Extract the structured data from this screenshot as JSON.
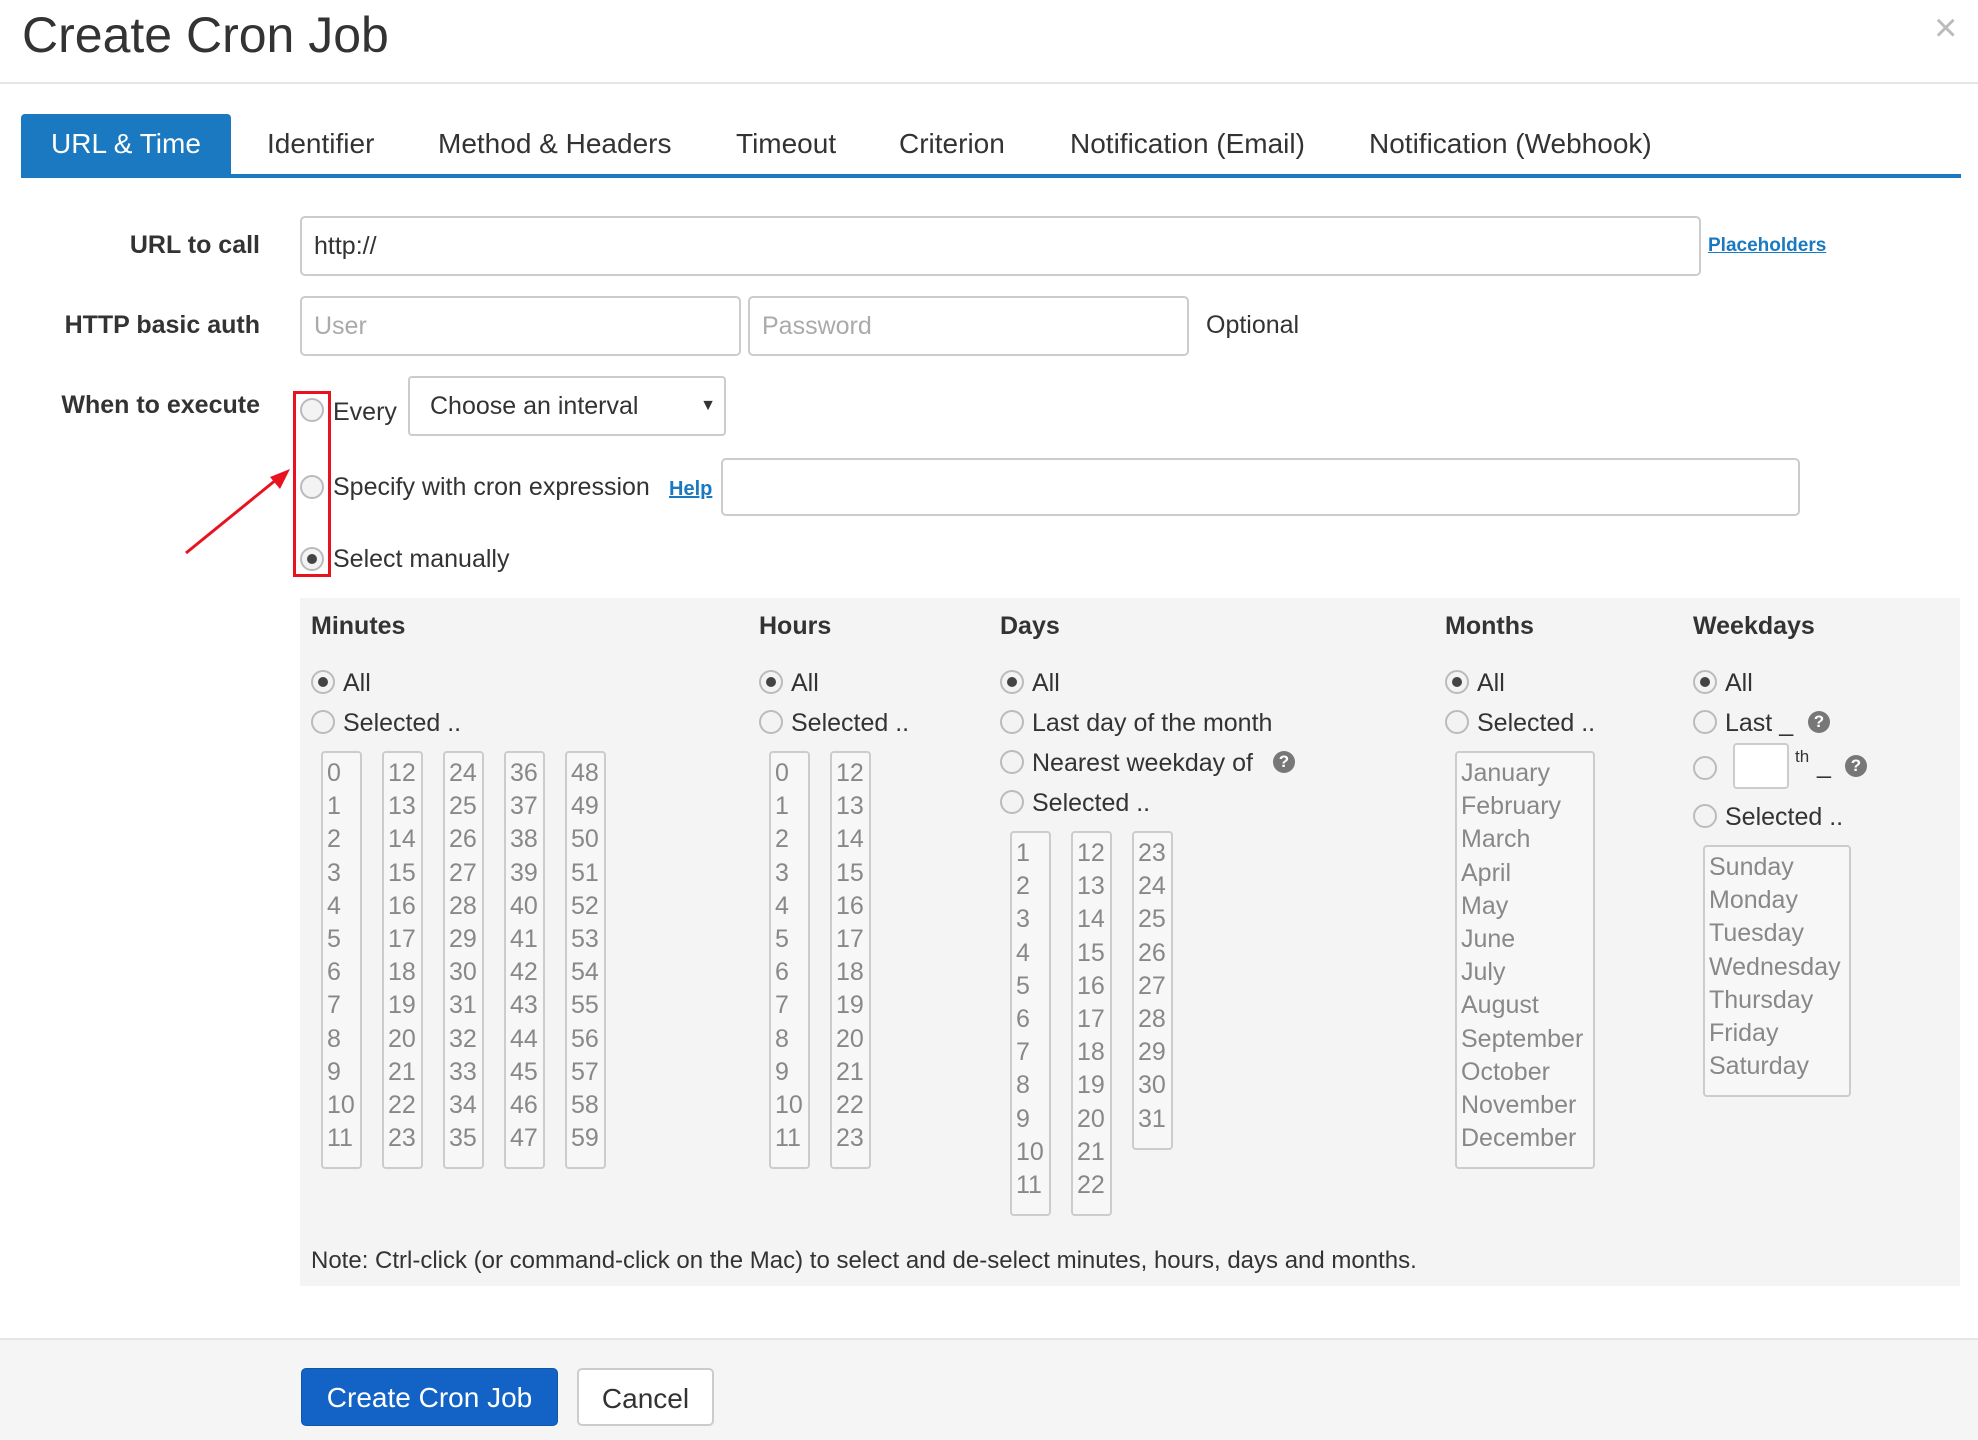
{
  "dialog": {
    "title": "Create Cron Job",
    "close": "×"
  },
  "tabs": [
    {
      "label": "URL & Time"
    },
    {
      "label": "Identifier"
    },
    {
      "label": "Method & Headers"
    },
    {
      "label": "Timeout"
    },
    {
      "label": "Criterion"
    },
    {
      "label": "Notification (Email)"
    },
    {
      "label": "Notification (Webhook)"
    }
  ],
  "url": {
    "label": "URL to call",
    "value": "http://",
    "placeholders_link": "Placeholders"
  },
  "auth": {
    "label": "HTTP basic auth",
    "user_placeholder": "User",
    "password_placeholder": "Password",
    "optional": "Optional"
  },
  "execute": {
    "label": "When to execute",
    "every": "Every",
    "interval_selected": "Choose an interval",
    "cron": "Specify with cron expression",
    "help_link": "Help",
    "manual": "Select manually"
  },
  "minutes": {
    "title": "Minutes",
    "all": "All",
    "selected": "Selected ..",
    "col1": [
      "0",
      "1",
      "2",
      "3",
      "4",
      "5",
      "6",
      "7",
      "8",
      "9",
      "10",
      "11"
    ],
    "col2": [
      "12",
      "13",
      "14",
      "15",
      "16",
      "17",
      "18",
      "19",
      "20",
      "21",
      "22",
      "23"
    ],
    "col3": [
      "24",
      "25",
      "26",
      "27",
      "28",
      "29",
      "30",
      "31",
      "32",
      "33",
      "34",
      "35"
    ],
    "col4": [
      "36",
      "37",
      "38",
      "39",
      "40",
      "41",
      "42",
      "43",
      "44",
      "45",
      "46",
      "47"
    ],
    "col5": [
      "48",
      "49",
      "50",
      "51",
      "52",
      "53",
      "54",
      "55",
      "56",
      "57",
      "58",
      "59"
    ]
  },
  "hours": {
    "title": "Hours",
    "all": "All",
    "selected": "Selected ..",
    "col1": [
      "0",
      "1",
      "2",
      "3",
      "4",
      "5",
      "6",
      "7",
      "8",
      "9",
      "10",
      "11"
    ],
    "col2": [
      "12",
      "13",
      "14",
      "15",
      "16",
      "17",
      "18",
      "19",
      "20",
      "21",
      "22",
      "23"
    ]
  },
  "days": {
    "title": "Days",
    "all": "All",
    "last_day": "Last day of the month",
    "nearest_weekday": "Nearest weekday of",
    "selected": "Selected ..",
    "col1": [
      "1",
      "2",
      "3",
      "4",
      "5",
      "6",
      "7",
      "8",
      "9",
      "10",
      "11"
    ],
    "col2": [
      "12",
      "13",
      "14",
      "15",
      "16",
      "17",
      "18",
      "19",
      "20",
      "21",
      "22"
    ],
    "col3": [
      "23",
      "24",
      "25",
      "26",
      "27",
      "28",
      "29",
      "30",
      "31"
    ]
  },
  "months": {
    "title": "Months",
    "all": "All",
    "selected": "Selected ..",
    "list": [
      "January",
      "February",
      "March",
      "April",
      "May",
      "June",
      "July",
      "August",
      "September",
      "October",
      "November",
      "December"
    ]
  },
  "weekdays": {
    "title": "Weekdays",
    "all": "All",
    "last": "Last _",
    "th": "th",
    "th_suffix": "_",
    "selected": "Selected ..",
    "list": [
      "Sunday",
      "Monday",
      "Tuesday",
      "Wednesday",
      "Thursday",
      "Friday",
      "Saturday"
    ]
  },
  "note": "Note: Ctrl-click (or command-click on the Mac) to select and de-select minutes, hours, days and months.",
  "footer": {
    "create": "Create Cron Job",
    "cancel": "Cancel"
  },
  "colors": {
    "accent": "#1a79c0",
    "primary_button": "#1363c6",
    "annotation": "#e8131f"
  }
}
